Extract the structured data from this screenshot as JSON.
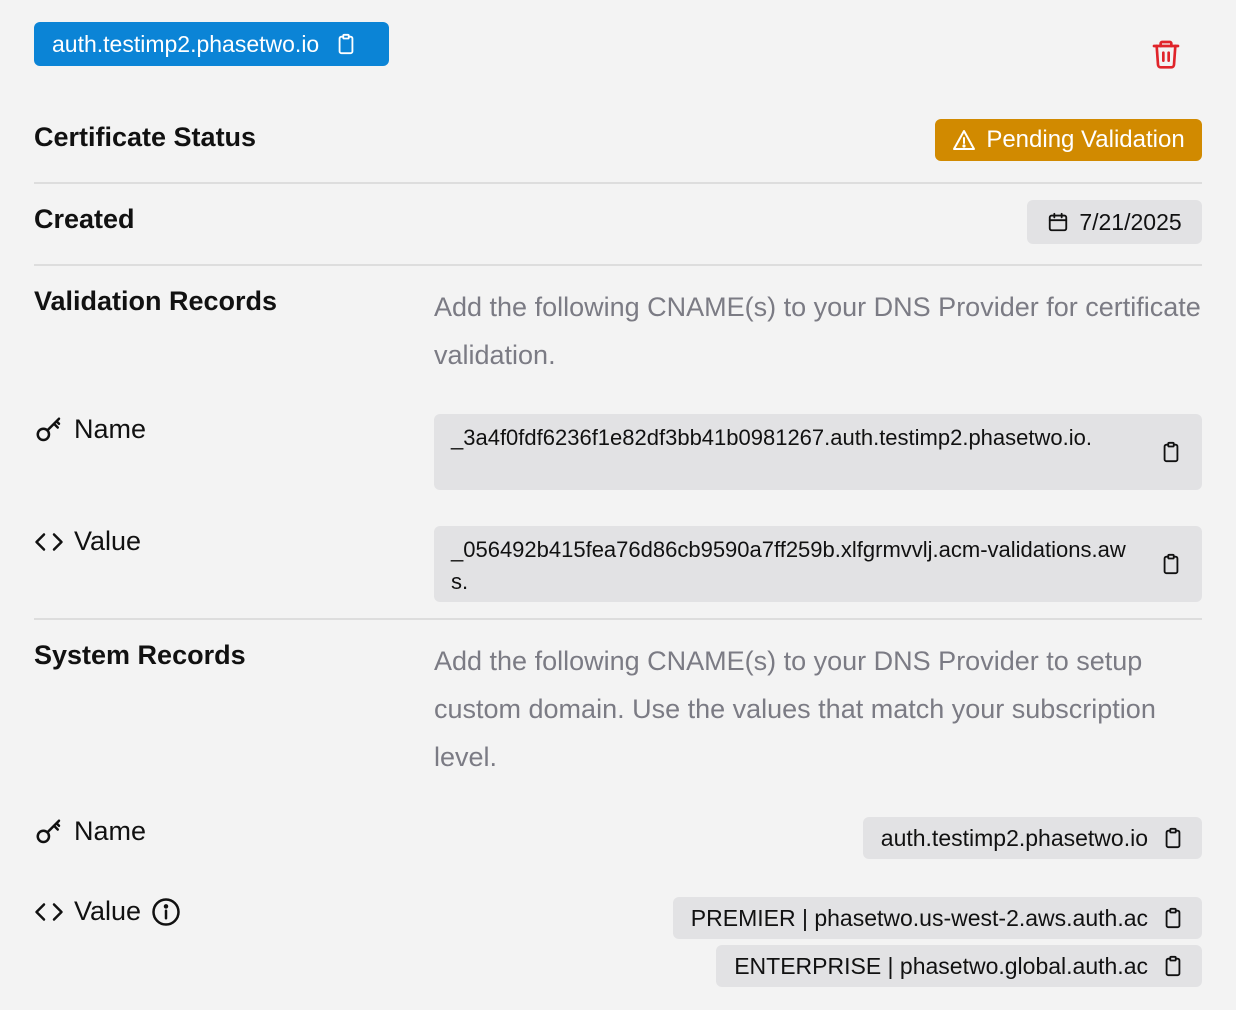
{
  "domain": {
    "name": "auth.testimp2.phasetwo.io"
  },
  "certificate_status": {
    "label": "Certificate Status",
    "status": "Pending Validation"
  },
  "created": {
    "label": "Created",
    "date": "7/21/2025"
  },
  "validation_records": {
    "label": "Validation Records",
    "description": "Add the following CNAME(s) to your DNS Provider for certificate validation.",
    "name_label": "Name",
    "name_value": "_3a4f0fdf6236f1e82df3bb41b0981267.auth.testimp2.phasetwo.io.",
    "value_label": "Value",
    "value_value": "_056492b415fea76d86cb9590a7ff259b.xlfgrmvvlj.acm-validations.aws."
  },
  "system_records": {
    "label": "System Records",
    "description": "Add the following CNAME(s) to your DNS Provider to setup custom domain. Use the values that match your subscription level.",
    "name_label": "Name",
    "name_value": "auth.testimp2.phasetwo.io",
    "value_label": "Value",
    "values": [
      "PREMIER | phasetwo.us-west-2.aws.auth.ac",
      "ENTERPRISE | phasetwo.global.auth.ac"
    ]
  },
  "colors": {
    "primary": "#0b84d6",
    "warning": "#d18a00",
    "danger": "#e0242a",
    "muted_text": "#7b7b84",
    "chip_bg": "#e2e2e4",
    "background": "#f3f3f3"
  }
}
